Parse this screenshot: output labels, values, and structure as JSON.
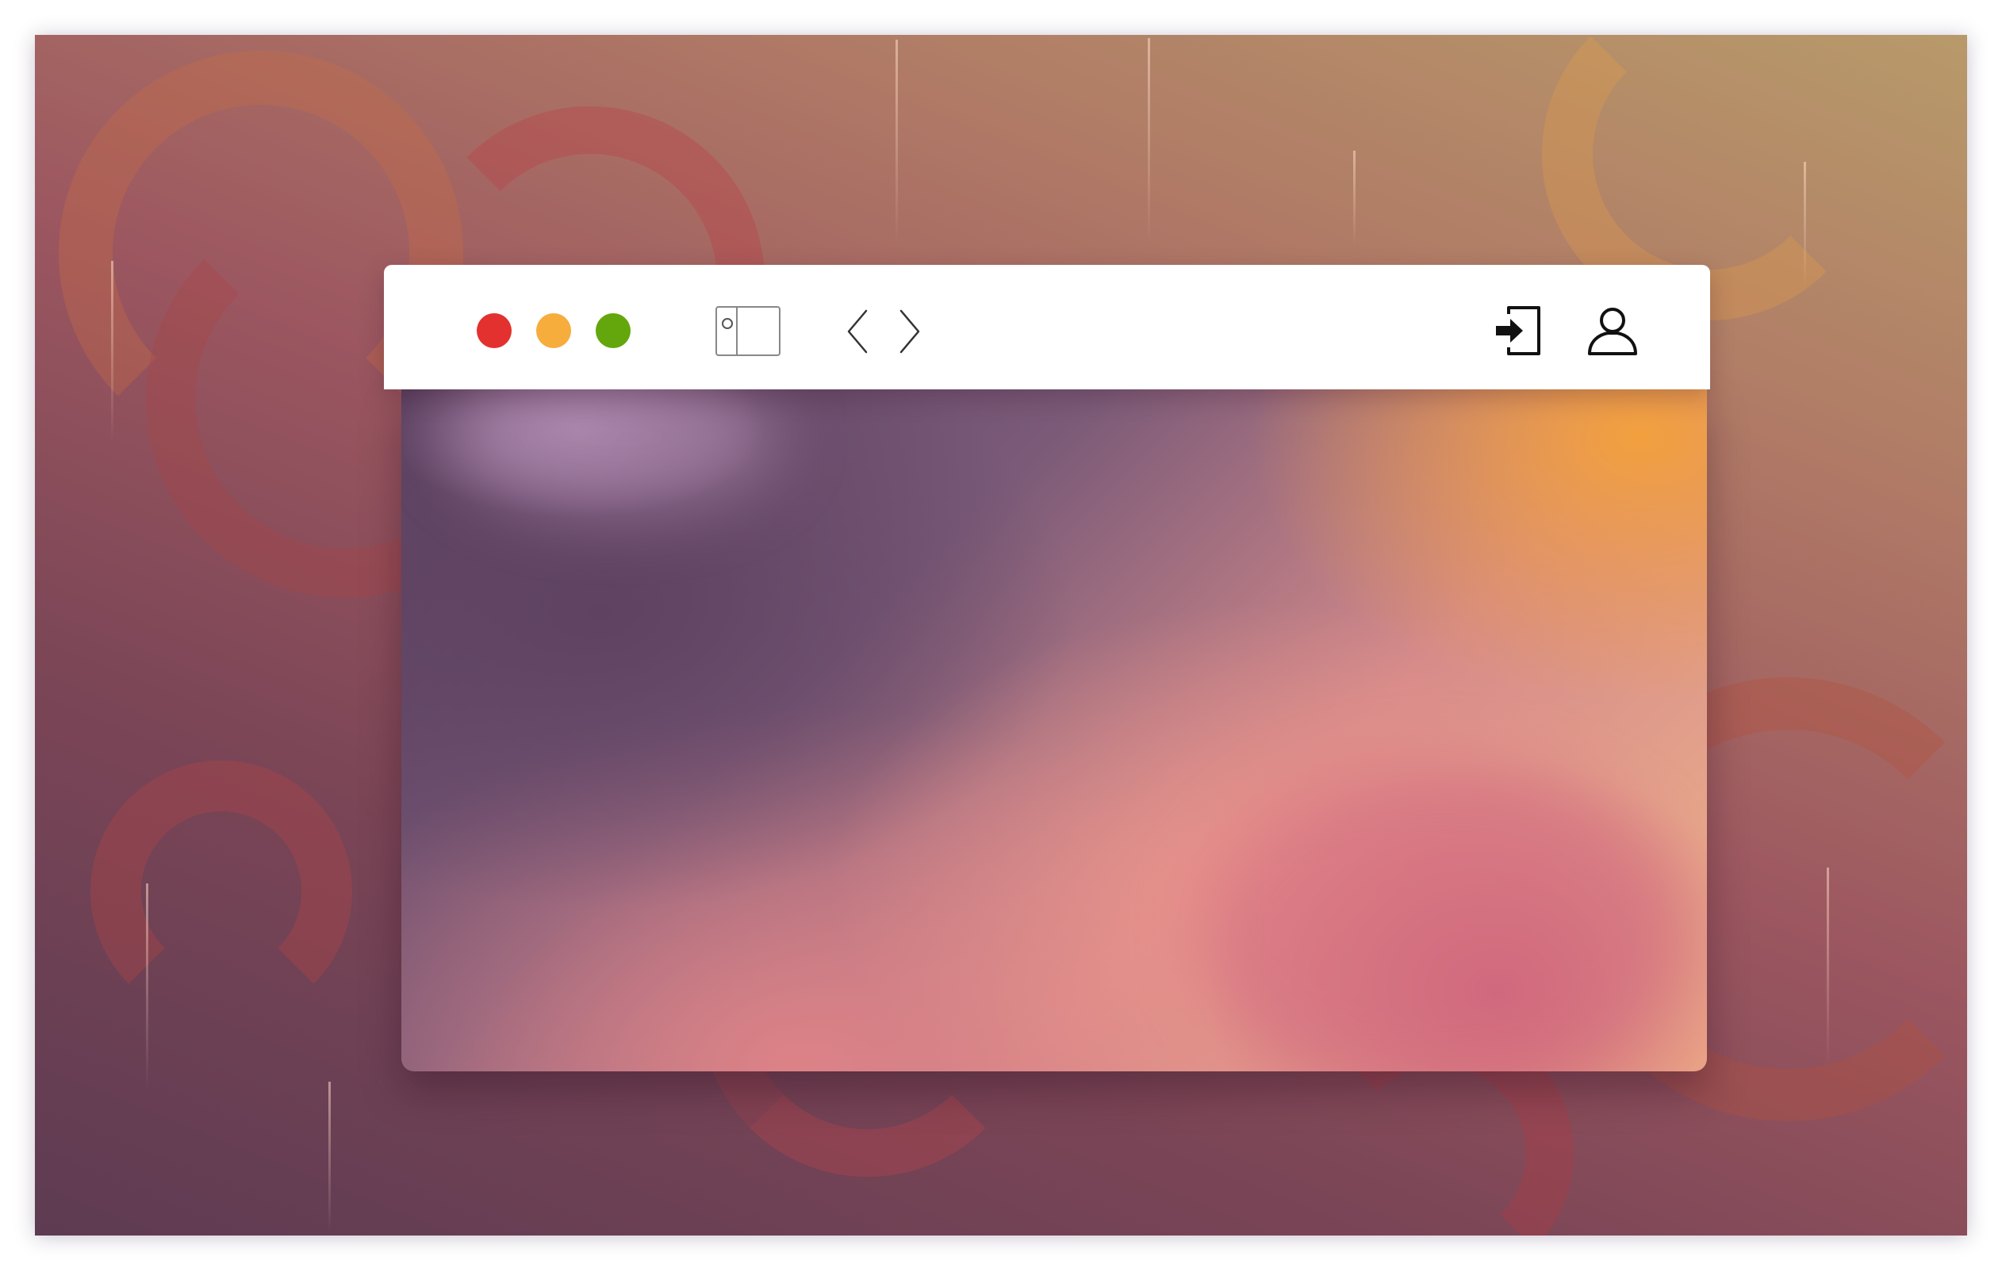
{
  "desktop": {
    "background_colors": [
      "#5e3b52",
      "#9c5760",
      "#b89a6a"
    ]
  },
  "window": {
    "traffic_lights": [
      {
        "name": "close",
        "color": "#e3312f"
      },
      {
        "name": "minimize",
        "color": "#f6ad3c"
      },
      {
        "name": "maximize",
        "color": "#63a70d"
      }
    ],
    "toolbar": {
      "icons": [
        "sidebar-toggle-icon",
        "back-chevron-icon",
        "forward-chevron-icon",
        "sign-in-icon",
        "user-account-icon"
      ]
    }
  }
}
